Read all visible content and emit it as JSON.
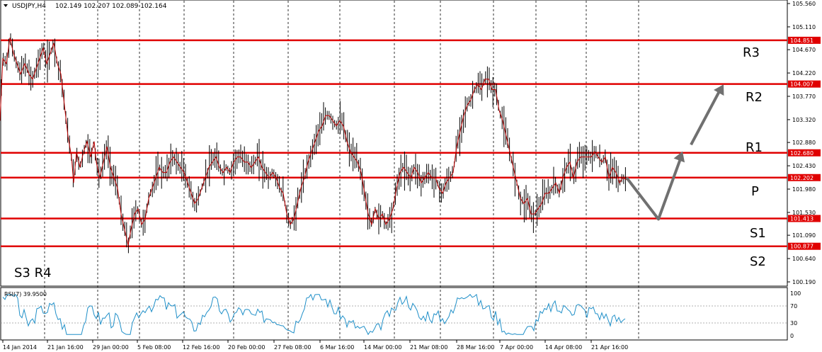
{
  "header": {
    "symbol": "USDJPY,H4",
    "ohlc": "102.149 102.207 102.089 102.164"
  },
  "chart_data": {
    "type": "candlestick",
    "symbol": "USDJPY",
    "timeframe": "H4",
    "ohlc_last": {
      "open": 102.149,
      "high": 102.207,
      "low": 102.089,
      "close": 102.164
    },
    "y_ticks": [
      "105.560",
      "105.110",
      "104.670",
      "104.220",
      "103.770",
      "103.320",
      "102.880",
      "102.430",
      "101.980",
      "101.530",
      "101.090",
      "100.640",
      "100.190"
    ],
    "x_ticks": [
      "14 Jan 2014",
      "21 Jan 16:00",
      "29 Jan 00:00",
      "5 Feb 08:00",
      "12 Feb 16:00",
      "20 Feb 00:00",
      "27 Feb 08:00",
      "6 Mar 16:00",
      "14 Mar 00:00",
      "21 Mar 08:00",
      "28 Mar 16:00",
      "7 Apr 00:00",
      "14 Apr 08:00",
      "21 Apr 16:00"
    ],
    "ylim": [
      100.05,
      105.63
    ],
    "price_series": [
      [
        0,
        103.3
      ],
      [
        4,
        104.5
      ],
      [
        9,
        104.4
      ],
      [
        14,
        104.9
      ],
      [
        19,
        104.6
      ],
      [
        24,
        104.4
      ],
      [
        29,
        104.2
      ],
      [
        35,
        104.4
      ],
      [
        41,
        104.2
      ],
      [
        46,
        104.1
      ],
      [
        51,
        104.3
      ],
      [
        56,
        104.5
      ],
      [
        61,
        104.7
      ],
      [
        66,
        104.4
      ],
      [
        71,
        104.6
      ],
      [
        76,
        104.8
      ],
      [
        81,
        104.4
      ],
      [
        86,
        104.2
      ],
      [
        91,
        103.6
      ],
      [
        96,
        103.0
      ],
      [
        101,
        102.6
      ],
      [
        104,
        102.1
      ],
      [
        108,
        102.7
      ],
      [
        113,
        102.4
      ],
      [
        118,
        102.7
      ],
      [
        123,
        102.9
      ],
      [
        128,
        102.6
      ],
      [
        133,
        102.9
      ],
      [
        136,
        102.5
      ],
      [
        141,
        102.2
      ],
      [
        146,
        102.5
      ],
      [
        151,
        102.8
      ],
      [
        156,
        102.4
      ],
      [
        161,
        102.2
      ],
      [
        166,
        102.0
      ],
      [
        171,
        101.5
      ],
      [
        176,
        101.2
      ],
      [
        181,
        100.9
      ],
      [
        185,
        101.2
      ],
      [
        190,
        101.5
      ],
      [
        195,
        101.6
      ],
      [
        200,
        101.3
      ],
      [
        205,
        101.4
      ],
      [
        210,
        101.8
      ],
      [
        215,
        102.0
      ],
      [
        220,
        102.2
      ],
      [
        225,
        102.4
      ],
      [
        230,
        102.3
      ],
      [
        235,
        102.3
      ],
      [
        240,
        102.5
      ],
      [
        245,
        102.6
      ],
      [
        250,
        102.5
      ],
      [
        255,
        102.4
      ],
      [
        260,
        102.3
      ],
      [
        265,
        102.1
      ],
      [
        270,
        101.9
      ],
      [
        275,
        101.7
      ],
      [
        280,
        101.8
      ],
      [
        285,
        102.0
      ],
      [
        290,
        102.2
      ],
      [
        295,
        102.4
      ],
      [
        300,
        102.5
      ],
      [
        305,
        102.6
      ],
      [
        310,
        102.4
      ],
      [
        315,
        102.3
      ],
      [
        320,
        102.4
      ],
      [
        325,
        102.3
      ],
      [
        330,
        102.5
      ],
      [
        335,
        102.6
      ],
      [
        340,
        102.6
      ],
      [
        345,
        102.5
      ],
      [
        350,
        102.5
      ],
      [
        355,
        102.4
      ],
      [
        360,
        102.5
      ],
      [
        365,
        102.6
      ],
      [
        370,
        102.4
      ],
      [
        375,
        102.3
      ],
      [
        380,
        102.2
      ],
      [
        385,
        102.3
      ],
      [
        390,
        102.2
      ],
      [
        395,
        102.0
      ],
      [
        400,
        101.9
      ],
      [
        405,
        101.5
      ],
      [
        410,
        101.3
      ],
      [
        415,
        101.4
      ],
      [
        420,
        101.7
      ],
      [
        425,
        102.0
      ],
      [
        430,
        102.2
      ],
      [
        435,
        102.5
      ],
      [
        440,
        102.7
      ],
      [
        445,
        102.9
      ],
      [
        450,
        103.1
      ],
      [
        455,
        103.2
      ],
      [
        460,
        103.4
      ],
      [
        465,
        103.4
      ],
      [
        470,
        103.3
      ],
      [
        475,
        103.2
      ],
      [
        480,
        103.3
      ],
      [
        485,
        103.2
      ],
      [
        490,
        102.9
      ],
      [
        495,
        102.7
      ],
      [
        500,
        102.6
      ],
      [
        505,
        102.5
      ],
      [
        510,
        102.3
      ],
      [
        515,
        101.9
      ],
      [
        520,
        101.5
      ],
      [
        525,
        101.3
      ],
      [
        530,
        101.6
      ],
      [
        535,
        101.4
      ],
      [
        540,
        101.5
      ],
      [
        545,
        101.3
      ],
      [
        550,
        101.4
      ],
      [
        555,
        101.6
      ],
      [
        560,
        102.0
      ],
      [
        565,
        102.3
      ],
      [
        570,
        102.4
      ],
      [
        575,
        102.3
      ],
      [
        580,
        102.2
      ],
      [
        585,
        102.4
      ],
      [
        590,
        102.3
      ],
      [
        595,
        102.1
      ],
      [
        600,
        102.2
      ],
      [
        605,
        102.3
      ],
      [
        610,
        102.2
      ],
      [
        615,
        102.2
      ],
      [
        620,
        102.0
      ],
      [
        625,
        101.9
      ],
      [
        630,
        102.1
      ],
      [
        635,
        102.2
      ],
      [
        640,
        102.3
      ],
      [
        645,
        102.8
      ],
      [
        650,
        103.1
      ],
      [
        655,
        103.4
      ],
      [
        660,
        103.6
      ],
      [
        665,
        103.7
      ],
      [
        670,
        103.9
      ],
      [
        675,
        104.0
      ],
      [
        680,
        103.9
      ],
      [
        685,
        104.1
      ],
      [
        690,
        104.1
      ],
      [
        695,
        103.9
      ],
      [
        700,
        103.9
      ],
      [
        705,
        103.5
      ],
      [
        710,
        103.3
      ],
      [
        715,
        103.0
      ],
      [
        720,
        102.7
      ],
      [
        725,
        102.4
      ],
      [
        730,
        102.1
      ],
      [
        735,
        101.8
      ],
      [
        740,
        101.7
      ],
      [
        745,
        101.8
      ],
      [
        750,
        101.5
      ],
      [
        755,
        101.5
      ],
      [
        760,
        101.6
      ],
      [
        765,
        101.7
      ],
      [
        770,
        101.9
      ],
      [
        775,
        101.9
      ],
      [
        780,
        102.0
      ],
      [
        785,
        102.1
      ],
      [
        790,
        101.9
      ],
      [
        795,
        102.2
      ],
      [
        800,
        102.4
      ],
      [
        805,
        102.5
      ],
      [
        810,
        102.2
      ],
      [
        815,
        102.5
      ],
      [
        820,
        102.6
      ],
      [
        825,
        102.6
      ],
      [
        830,
        102.6
      ],
      [
        835,
        102.6
      ],
      [
        840,
        102.7
      ],
      [
        845,
        102.6
      ],
      [
        850,
        102.5
      ],
      [
        855,
        102.6
      ],
      [
        860,
        102.2
      ],
      [
        865,
        102.4
      ],
      [
        870,
        102.3
      ],
      [
        875,
        102.1
      ],
      [
        880,
        102.2
      ],
      [
        885,
        102.16
      ]
    ],
    "pivot_levels": [
      {
        "name": "R3",
        "price_label": "104.851",
        "price": 104.851
      },
      {
        "name": "R2",
        "price_label": "104.007",
        "price": 104.007
      },
      {
        "name": "R1",
        "price_label": "102.680",
        "price": 102.68
      },
      {
        "name": "P",
        "price_label": "102.202",
        "price": 102.202
      },
      {
        "name": "S1",
        "price_label": "101.413",
        "price": 101.413
      },
      {
        "name": "S2",
        "price_label": "100.877",
        "price": 100.877
      }
    ],
    "extra_label": "S3 R4",
    "forecast_arrow": [
      [
        885,
        102.2
      ],
      [
        930,
        101.4
      ],
      [
        962,
        102.6
      ],
      [
        968,
        102.7
      ],
      [
        1022,
        104.0
      ]
    ],
    "forecast_color": "#707070",
    "level_color": "#e00000",
    "ma_color": "#c00000",
    "rsi": {
      "label": "RSI(7) 39.9500",
      "ticks": [
        "100",
        "70",
        "30",
        "0"
      ],
      "levels": [
        70,
        30
      ],
      "color": "#1f8fc8",
      "last": 39.95
    }
  }
}
